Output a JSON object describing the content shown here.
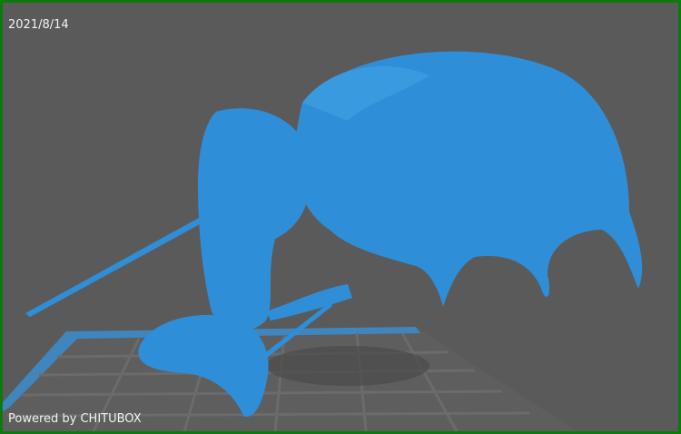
{
  "viewport": {
    "date": "2021/8/14",
    "watermark": "Powered by CHITUBOX"
  },
  "colors": {
    "background": "#5a5a5a",
    "border": "#0c7a0c",
    "model": "#2e8fd8",
    "plate_edge": "#3f86bf",
    "grid": "#6b6b6b"
  }
}
